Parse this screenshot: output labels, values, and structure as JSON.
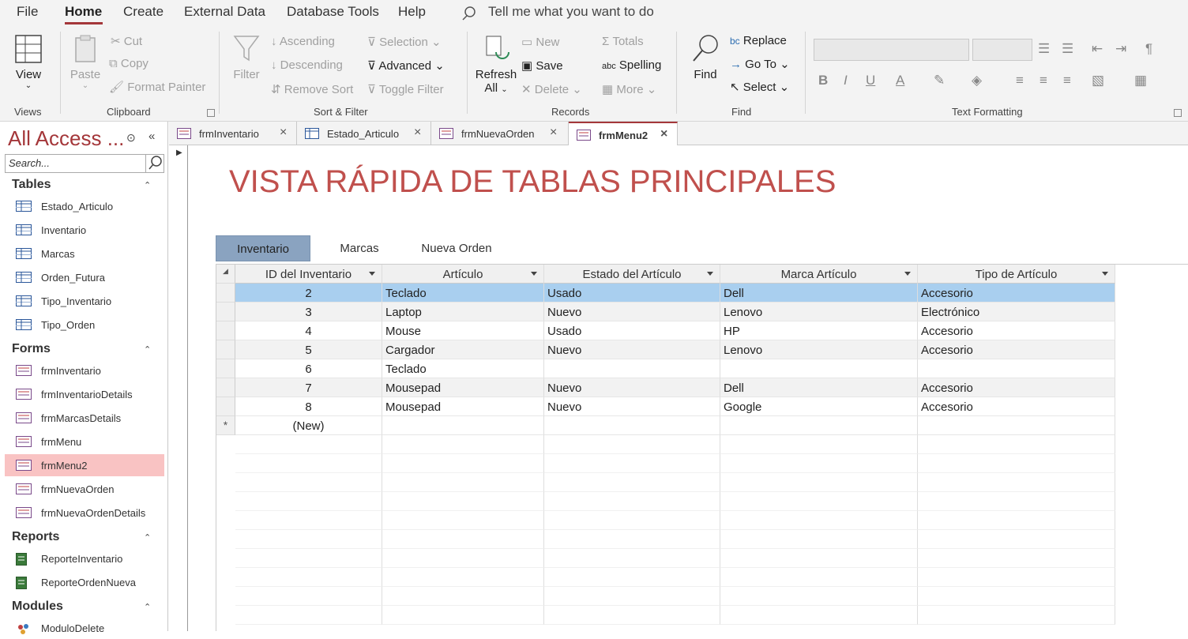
{
  "menu": {
    "items": [
      "File",
      "Home",
      "Create",
      "External Data",
      "Database Tools",
      "Help"
    ],
    "tell_me": "Tell me what you want to do"
  },
  "ribbon": {
    "views": {
      "label": "Views",
      "view": "View"
    },
    "clipboard": {
      "label": "Clipboard",
      "paste": "Paste",
      "cut": "Cut",
      "copy": "Copy",
      "format_painter": "Format Painter"
    },
    "sort_filter": {
      "label": "Sort & Filter",
      "filter": "Filter",
      "ascending": "Ascending",
      "descending": "Descending",
      "remove_sort": "Remove Sort",
      "selection": "Selection",
      "advanced": "Advanced",
      "toggle_filter": "Toggle Filter"
    },
    "records": {
      "label": "Records",
      "refresh": "Refresh",
      "all": "All",
      "new": "New",
      "save": "Save",
      "delete": "Delete",
      "totals": "Totals",
      "spelling": "Spelling",
      "more": "More"
    },
    "find": {
      "label": "Find",
      "find": "Find",
      "replace": "Replace",
      "goto": "Go To",
      "select": "Select"
    },
    "text_formatting": {
      "label": "Text Formatting"
    }
  },
  "nav": {
    "title": "All Access ...",
    "search_placeholder": "Search...",
    "sections": [
      {
        "name": "Tables",
        "items": [
          "Estado_Articulo",
          "Inventario",
          "Marcas",
          "Orden_Futura",
          "Tipo_Inventario",
          "Tipo_Orden"
        ]
      },
      {
        "name": "Forms",
        "items": [
          "frmInventario",
          "frmInventarioDetails",
          "frmMarcasDetails",
          "frmMenu",
          "frmMenu2",
          "frmNuevaOrden",
          "frmNuevaOrdenDetails"
        ]
      },
      {
        "name": "Reports",
        "items": [
          "ReporteInventario",
          "ReporteOrdenNueva"
        ]
      },
      {
        "name": "Modules",
        "items": [
          "ModuloDelete"
        ]
      }
    ],
    "selected": "frmMenu2"
  },
  "doc_tabs": [
    "frmInventario",
    "Estado_Articulo",
    "frmNuevaOrden",
    "frmMenu2"
  ],
  "form": {
    "title": "VISTA RÁPIDA DE TABLAS PRINCIPALES",
    "tabs": [
      "Inventario",
      "Marcas",
      "Nueva Orden"
    ],
    "columns": [
      "ID del Inventario",
      "Artículo",
      "Estado del Artículo",
      "Marca Artículo",
      "Tipo de Artículo"
    ],
    "rows": [
      [
        "2",
        "Teclado",
        "Usado",
        "Dell",
        "Accesorio"
      ],
      [
        "3",
        "Laptop",
        "Nuevo",
        "Lenovo",
        "Electrónico"
      ],
      [
        "4",
        "Mouse",
        "Usado",
        "HP",
        "Accesorio"
      ],
      [
        "5",
        "Cargador",
        "Nuevo",
        "Lenovo",
        "Accesorio"
      ],
      [
        "6",
        "Teclado",
        "",
        "",
        ""
      ],
      [
        "7",
        "Mousepad",
        "Nuevo",
        "Dell",
        "Accesorio"
      ],
      [
        "8",
        "Mousepad",
        "Nuevo",
        "Google",
        "Accesorio"
      ]
    ],
    "new_row": "(New)",
    "new_marker": "*"
  },
  "colors": {
    "accent": "#a4373a",
    "title": "#c0504d",
    "selected_row": "#a9cfef",
    "active_tab": "#8aa3c0"
  }
}
